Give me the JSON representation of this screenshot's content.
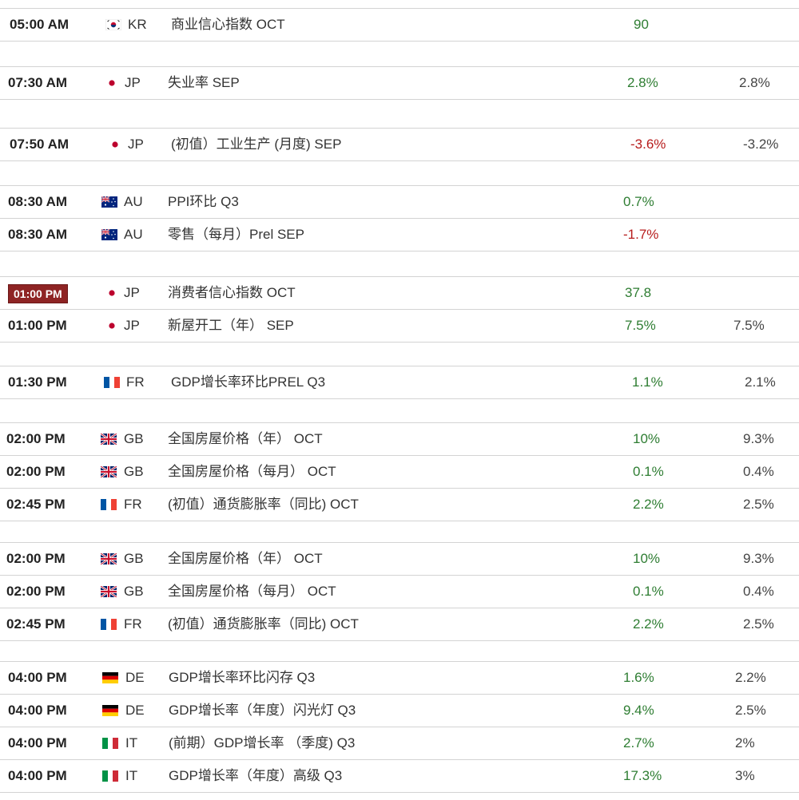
{
  "colors": {
    "positive": "#2e7d32",
    "negative": "#b71c1c",
    "highlight": "#8e2424"
  },
  "groups": [
    {
      "rows": [
        {
          "time": "05:00 AM",
          "flag": "kr-flag-icon",
          "country": "KR",
          "name": "商业信心指数 OCT",
          "actual": "90",
          "trend": "pos",
          "prev": ""
        }
      ]
    },
    {
      "rows": [
        {
          "time": "07:30 AM",
          "flag": "jp-flag-icon",
          "country": "JP",
          "name": "失业率 SEP",
          "actual": "2.8%",
          "trend": "pos",
          "prev": "2.8%"
        }
      ]
    },
    {
      "rows": [
        {
          "time": "07:50 AM",
          "flag": "jp-flag-icon",
          "country": "JP",
          "name": "(初值）工业生产 (月度) SEP",
          "actual": "-3.6%",
          "trend": "neg",
          "prev": "-3.2%"
        }
      ]
    },
    {
      "rows": [
        {
          "time": "08:30 AM",
          "flag": "au-flag-icon",
          "country": "AU",
          "name": "PPI环比 Q3",
          "actual": "0.7%",
          "trend": "pos",
          "prev": ""
        },
        {
          "time": "08:30 AM",
          "flag": "au-flag-icon",
          "country": "AU",
          "name": "零售（每月）Prel SEP",
          "actual": "-1.7%",
          "trend": "neg",
          "prev": ""
        }
      ]
    },
    {
      "rows": [
        {
          "time": "01:00 PM",
          "highlight": true,
          "flag": "jp-flag-icon",
          "country": "JP",
          "name": "消费者信心指数 OCT",
          "actual": "37.8",
          "trend": "pos",
          "prev": ""
        },
        {
          "time": "01:00 PM",
          "flag": "jp-flag-icon",
          "country": "JP",
          "name": "新屋开工（年） SEP",
          "actual": "7.5%",
          "trend": "pos",
          "prev": "7.5%"
        }
      ]
    },
    {
      "rows": [
        {
          "time": "01:30 PM",
          "flag": "fr-flag-icon",
          "country": "FR",
          "name": "GDP增长率环比PREL Q3",
          "actual": "1.1%",
          "trend": "pos",
          "prev": "2.1%"
        }
      ]
    },
    {
      "rows": [
        {
          "time": "02:00 PM",
          "flag": "gb-flag-icon",
          "country": "GB",
          "name": "全国房屋价格（年） OCT",
          "actual": "10%",
          "trend": "pos",
          "prev": "9.3%"
        },
        {
          "time": "02:00 PM",
          "flag": "gb-flag-icon",
          "country": "GB",
          "name": "全国房屋价格（每月） OCT",
          "actual": "0.1%",
          "trend": "pos",
          "prev": "0.4%"
        },
        {
          "time": "02:45 PM",
          "flag": "fr-flag-icon",
          "country": "FR",
          "name": "(初值）通货膨胀率（同比) OCT",
          "actual": "2.2%",
          "trend": "pos",
          "prev": "2.5%"
        }
      ]
    },
    {
      "rows": [
        {
          "time": "02:00 PM",
          "flag": "gb-flag-icon",
          "country": "GB",
          "name": "全国房屋价格（年） OCT",
          "actual": "10%",
          "trend": "pos",
          "prev": "9.3%"
        },
        {
          "time": "02:00 PM",
          "flag": "gb-flag-icon",
          "country": "GB",
          "name": "全国房屋价格（每月） OCT",
          "actual": "0.1%",
          "trend": "pos",
          "prev": "0.4%"
        },
        {
          "time": "02:45 PM",
          "flag": "fr-flag-icon",
          "country": "FR",
          "name": "(初值）通货膨胀率（同比) OCT",
          "actual": "2.2%",
          "trend": "pos",
          "prev": "2.5%"
        }
      ]
    },
    {
      "rows": [
        {
          "time": "04:00 PM",
          "flag": "de-flag-icon",
          "country": "DE",
          "name": "GDP增长率环比闪存 Q3",
          "actual": "1.6%",
          "trend": "pos",
          "prev": "2.2%"
        },
        {
          "time": "04:00 PM",
          "flag": "de-flag-icon",
          "country": "DE",
          "name": "GDP增长率（年度）闪光灯 Q3",
          "actual": "9.4%",
          "trend": "pos",
          "prev": "2.5%"
        },
        {
          "time": "04:00 PM",
          "flag": "it-flag-icon",
          "country": "IT",
          "name": "(前期）GDP增长率 （季度) Q3",
          "actual": "2.7%",
          "trend": "pos",
          "prev": "2%"
        },
        {
          "time": "04:00 PM",
          "flag": "it-flag-icon",
          "country": "IT",
          "name": "GDP增长率（年度）高级 Q3",
          "actual": "17.3%",
          "trend": "pos",
          "prev": "3%"
        }
      ]
    }
  ]
}
